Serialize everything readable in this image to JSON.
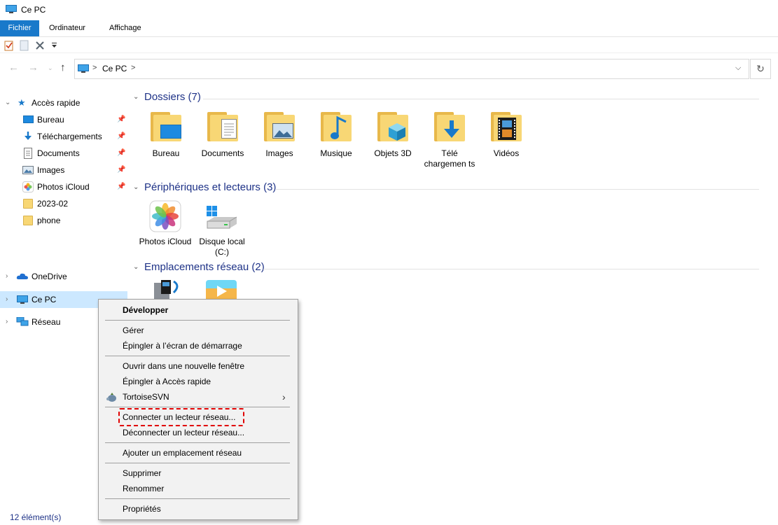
{
  "window": {
    "title": "Ce PC"
  },
  "ribbon": {
    "tabs": [
      "Fichier",
      "Ordinateur",
      "Affichage"
    ]
  },
  "address": {
    "segments": [
      "Ce PC"
    ],
    "separator": ">"
  },
  "sidebar": {
    "quick_access": {
      "label": "Accès rapide",
      "items": [
        {
          "label": "Bureau",
          "icon": "desktop-icon",
          "pinned": true
        },
        {
          "label": "Téléchargements",
          "icon": "download-icon",
          "pinned": true
        },
        {
          "label": "Documents",
          "icon": "document-icon",
          "pinned": true
        },
        {
          "label": "Images",
          "icon": "image-icon",
          "pinned": true
        },
        {
          "label": "Photos iCloud",
          "icon": "photos-icon",
          "pinned": true
        },
        {
          "label": "2023-02",
          "icon": "folder-icon",
          "pinned": false
        },
        {
          "label": "phone",
          "icon": "folder-icon",
          "pinned": false
        }
      ]
    },
    "onedrive": {
      "label": "OneDrive"
    },
    "this_pc": {
      "label": "Ce PC"
    },
    "network": {
      "label": "Réseau"
    }
  },
  "main": {
    "folders": {
      "header": "Dossiers (7)",
      "items": [
        {
          "label": "Bureau",
          "icon": "desktop-folder-icon"
        },
        {
          "label": "Documents",
          "icon": "documents-folder-icon"
        },
        {
          "label": "Images",
          "icon": "images-folder-icon"
        },
        {
          "label": "Musique",
          "icon": "music-folder-icon"
        },
        {
          "label": "Objets 3D",
          "icon": "3d-objects-folder-icon"
        },
        {
          "label": "Télé chargemen ts",
          "icon": "downloads-folder-icon"
        },
        {
          "label": "Vidéos",
          "icon": "videos-folder-icon"
        }
      ]
    },
    "devices": {
      "header": "Périphériques et lecteurs (3)",
      "items": [
        {
          "label": "Photos iCloud",
          "icon": "icloud-photos-icon"
        },
        {
          "label": "Disque local (C:)",
          "icon": "local-disk-icon"
        }
      ]
    },
    "network": {
      "header": "Emplacements réseau (2)"
    }
  },
  "context_menu": {
    "items": [
      {
        "label": "Développer",
        "bold": true
      },
      {
        "label": "Gérer"
      },
      {
        "label": "Épingler à l’écran de démarrage"
      },
      {
        "label": "Ouvrir dans une nouvelle fenêtre"
      },
      {
        "label": "Épingler à Accès rapide"
      },
      {
        "label": "TortoiseSVN",
        "submenu": true
      },
      {
        "label": "Connecter un lecteur réseau...",
        "highlighted": true
      },
      {
        "label": "Déconnecter un lecteur réseau..."
      },
      {
        "label": "Ajouter un emplacement réseau"
      },
      {
        "label": "Supprimer"
      },
      {
        "label": "Renommer"
      },
      {
        "label": "Propriétés"
      }
    ]
  },
  "status": {
    "count": "12 élément(s)"
  },
  "colors": {
    "accent": "#1979ca",
    "header_text": "#1e3287",
    "selection": "#cce8ff",
    "highlight_border": "#e00000"
  }
}
